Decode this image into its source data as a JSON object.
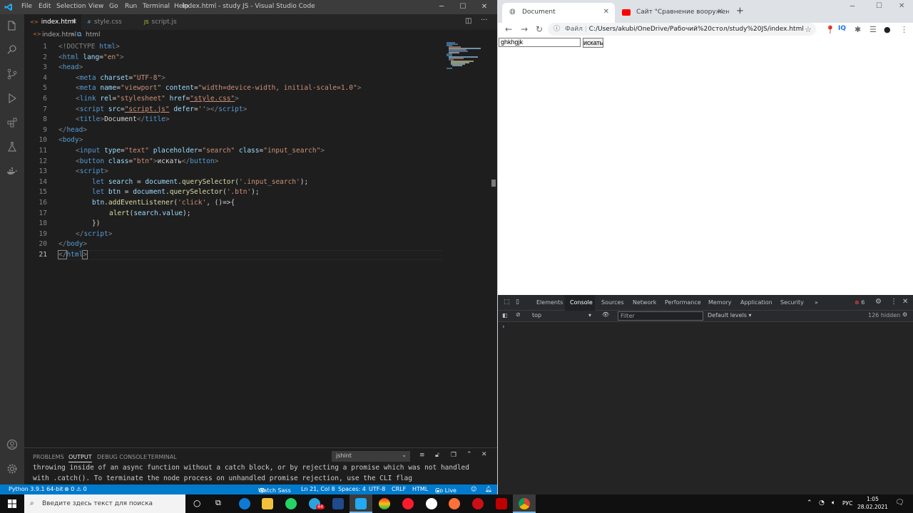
{
  "vscode": {
    "menu": [
      "File",
      "Edit",
      "Selection",
      "View",
      "Go",
      "Run",
      "Terminal",
      "Help"
    ],
    "title": "index.html - study JS - Visual Studio Code",
    "tabs": [
      {
        "icon": "<>",
        "label": "index.html"
      },
      {
        "icon": "#",
        "label": "style.css"
      },
      {
        "icon": "JS",
        "label": "script.js"
      }
    ],
    "breadcrumb": {
      "file": "index.html",
      "node": "html"
    },
    "line_numbers": [
      "1",
      "2",
      "3",
      "4",
      "5",
      "6",
      "7",
      "8",
      "9",
      "10",
      "11",
      "12",
      "13",
      "14",
      "15",
      "16",
      "17",
      "18",
      "19",
      "20",
      "21"
    ],
    "code": {
      "l1": {
        "a": "<!DOCTYPE ",
        "b": "html",
        "c": ">"
      },
      "l2": {
        "a": "<",
        "b": "html",
        "c": " lang",
        "d": "=",
        "e": "\"en\"",
        "f": ">"
      },
      "l3": {
        "a": "<",
        "b": "head",
        "c": ">"
      },
      "l4": {
        "a": "<",
        "b": "meta",
        "c": " charset",
        "d": "=",
        "e": "\"UTF-8\"",
        "f": ">"
      },
      "l5": {
        "a": "<",
        "b": "meta",
        "c": " name",
        "d": "=",
        "e": "\"viewport\"",
        "g": " content",
        "h": "=",
        "i": "\"width=device-width, initial-scale=1.0\"",
        "f": ">"
      },
      "l6": {
        "a": "<",
        "b": "link",
        "c": " rel",
        "d": "=",
        "e": "\"stylesheet\"",
        "g": " href",
        "h": "=",
        "i": "\"style.css\"",
        "f": ">"
      },
      "l7": {
        "a": "<",
        "b": "script",
        "c": " src",
        "d": "=",
        "e": "\"script.js\"",
        "g": " defer",
        "h": "=",
        "i": "''",
        "j": "></",
        "k": "script",
        "f": ">"
      },
      "l8": {
        "a": "<",
        "b": "title",
        "c": ">",
        "d": "Document",
        "e": "</",
        "g": "title",
        "f": ">"
      },
      "l9": {
        "a": "</",
        "b": "head",
        "c": ">"
      },
      "l10": {
        "a": "<",
        "b": "body",
        "c": ">"
      },
      "l11": {
        "a": "<",
        "b": "input",
        "c": " type",
        "d": "=",
        "e": "\"text\"",
        "g": " placeholder",
        "h": "=",
        "i": "\"search\"",
        "j": " class",
        "k": "=",
        "m": "\"input_search\"",
        "f": ">"
      },
      "l12": {
        "a": "<",
        "b": "button",
        "c": " class",
        "d": "=",
        "e": "\"btn\"",
        "g": ">",
        "h": "искать",
        "i": "</",
        "j": "button",
        "f": ">"
      },
      "l13": {
        "a": "<",
        "b": "script",
        "c": ">"
      },
      "l14": {
        "a": "let ",
        "b": "search",
        "c": " = ",
        "d": "document",
        "e": ".",
        "g": "querySelector",
        "h": "(",
        "i": "'.input_search'",
        "f": ");"
      },
      "l15": {
        "a": "let ",
        "b": "btn",
        "c": " = ",
        "d": "document",
        "e": ".",
        "g": "querySelector",
        "h": "(",
        "i": "'.btn'",
        "f": ");"
      },
      "l16": {
        "a": "btn",
        "b": ".",
        "c": "addEventListener",
        "d": "(",
        "e": "'click'",
        "f": ", ()=>{"
      },
      "l17": {
        "a": "alert",
        "b": "(",
        "c": "search",
        "d": ".",
        "e": "value",
        "f": ");"
      },
      "l18": {
        "a": "})"
      },
      "l19": {
        "a": "</",
        "b": "script",
        "c": ">"
      },
      "l20": {
        "a": "</",
        "b": "body",
        "c": ">"
      },
      "l21": {
        "a": "</",
        "b": "html",
        "c": ">"
      }
    },
    "panel": {
      "tabs": [
        "PROBLEMS",
        "OUTPUT",
        "DEBUG CONSOLE",
        "TERMINAL"
      ],
      "select": "jshint",
      "output": [
        "throwing inside of an async function without a catch block, or by rejecting a promise which was not handled",
        "with .catch(). To terminate the node process on unhandled promise rejection, use the CLI flag"
      ]
    },
    "status": {
      "python": "Python 3.9.1 64-bit",
      "problems": "⊗ 0 ⚠ 0",
      "watch": "Watch Sass",
      "position": "Ln 21, Col 8",
      "spaces": "Spaces: 4",
      "encoding": "UTF-8",
      "eol": "CRLF",
      "lang": "HTML",
      "golive": "Go Live"
    }
  },
  "chrome": {
    "tabs": [
      {
        "label": "Document"
      },
      {
        "label": "Сайт \"Сравнение вооружений"
      }
    ],
    "omnibox_label": "Файл",
    "url": "C:/Users/akubi/OneDrive/Рабочий%20стол/study%20JS/index.html",
    "page": {
      "input_value": "ghkhgjk",
      "button_label": "искать"
    },
    "devtools": {
      "tabs": [
        "Elements",
        "Console",
        "Sources",
        "Network",
        "Performance",
        "Memory",
        "Application",
        "Security"
      ],
      "error_count": "6",
      "context": "top",
      "filter_placeholder": "Filter",
      "levels": "Default levels ▾",
      "hidden": "126 hidden",
      "prompt": "›"
    }
  },
  "taskbar": {
    "search_placeholder": "Введите здесь текст для поиска",
    "lang": "РУС",
    "time": "1:05",
    "date": "28.02.2021",
    "badge": "44"
  },
  "colors": {
    "vscode_accent": "#007acc",
    "chrome_error": "#ee4444"
  }
}
